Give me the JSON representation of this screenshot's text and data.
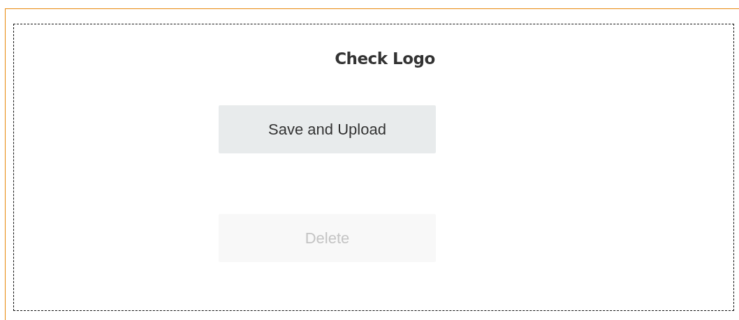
{
  "title": "Check Logo",
  "buttons": [
    {
      "label": "Save and Upload",
      "disabled": false
    },
    {
      "label": "Delete",
      "disabled": true
    }
  ]
}
